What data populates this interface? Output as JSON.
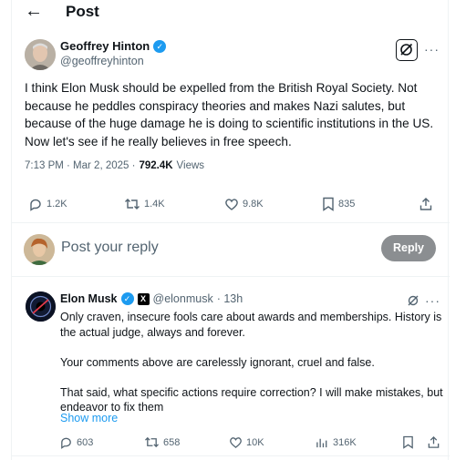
{
  "header": {
    "title": "Post"
  },
  "post": {
    "author_name": "Geoffrey Hinton",
    "author_handle": "@geoffreyhinton",
    "text": "I think Elon Musk should be expelled from the British Royal Society. Not because he peddles conspiracy theories and makes Nazi salutes, but because of the huge damage he is doing to scientific institutions in the US. Now let's see if he really believes in free speech.",
    "time": "7:13 PM · Mar 2, 2025 ·",
    "views_count": "792.4K",
    "views_label": "Views",
    "stats": {
      "replies": "1.2K",
      "reposts": "1.4K",
      "likes": "9.8K",
      "bookmarks": "835"
    }
  },
  "reply_box": {
    "placeholder": "Post your reply",
    "button": "Reply"
  },
  "reply": {
    "author_name": "Elon Musk",
    "author_handle": "@elonmusk",
    "time": "· 13h",
    "paragraphs": [
      "Only craven, insecure fools care about awards and memberships. History is the actual judge, always and forever.",
      "Your comments above are carelessly ignorant, cruel and false.",
      "That said, what specific actions require correction? I will make mistakes, but endeavor to fix them"
    ],
    "show_more": "Show more",
    "stats": {
      "replies": "603",
      "reposts": "658",
      "likes": "10K",
      "views": "316K"
    }
  },
  "colors": {
    "accent": "#1d9bf0",
    "muted": "#536471",
    "text": "#0f1419",
    "reply_button": "#8b8e91"
  }
}
